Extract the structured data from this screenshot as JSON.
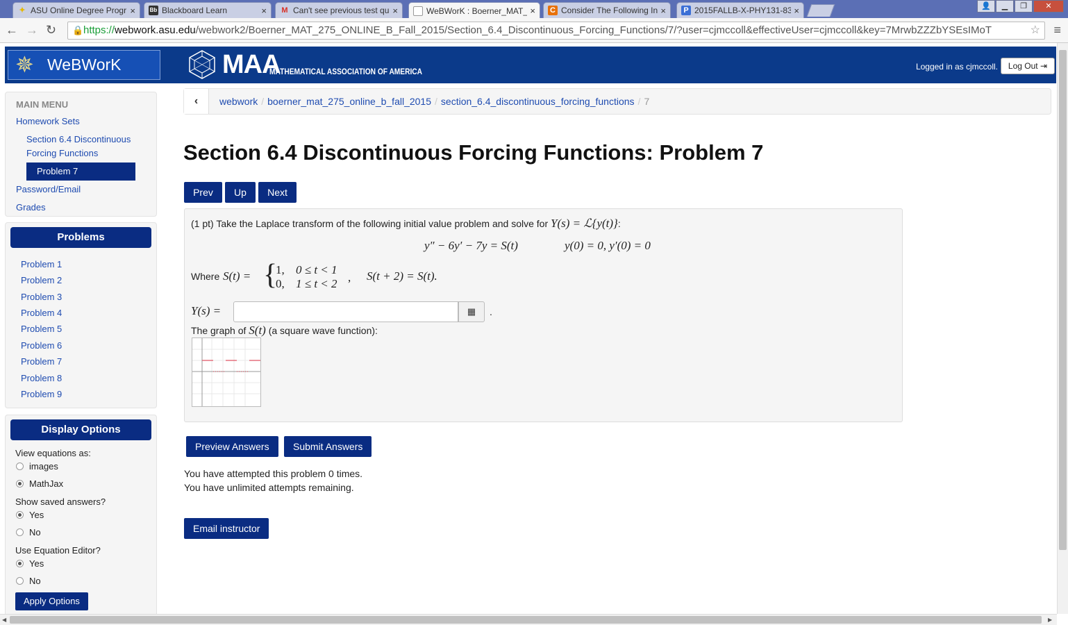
{
  "browser": {
    "tabs": [
      {
        "label": "ASU Online Degree Progr",
        "favicon": "A",
        "color": "#e6b800"
      },
      {
        "label": "Blackboard Learn",
        "favicon": "Bb",
        "color": "#333333"
      },
      {
        "label": "Can't see previous test qu",
        "favicon": "M",
        "color": "#d93025"
      },
      {
        "label": "WeBWorK : Boerner_MAT_",
        "favicon": "□",
        "color": "#777777"
      },
      {
        "label": "Consider The Following In",
        "favicon": "C",
        "color": "#e8710a"
      },
      {
        "label": "2015FALLB-X-PHY131-83",
        "favicon": "P",
        "color": "#3b6fd6"
      }
    ],
    "url_scheme": "https://",
    "url_domain": "webwork.asu.edu",
    "url_path": "/webwork2/Boerner_MAT_275_ONLINE_B_Fall_2015/Section_6.4_Discontinuous_Forcing_Functions/7/?user=cjmccoll&effectiveUser=cjmccoll&key=7MrwbZZZbYSEsIMoT"
  },
  "header": {
    "logo_text": "WeBWorK",
    "maa_big": "MAA",
    "maa_small": "MATHEMATICAL ASSOCIATION OF AMERICA",
    "logged_in": "Logged in as cjmccoll.",
    "logout": "Log Out"
  },
  "sidebar": {
    "main_menu_title": "MAIN MENU",
    "homework_sets": "Homework Sets",
    "section_line1": "Section 6.4 Discontinuous",
    "section_line2": "Forcing Functions",
    "current_problem": "Problem 7",
    "password_email": "Password/Email",
    "grades": "Grades",
    "problems_title": "Problems",
    "problems": [
      "Problem 1",
      "Problem 2",
      "Problem 3",
      "Problem 4",
      "Problem 5",
      "Problem 6",
      "Problem 7",
      "Problem 8",
      "Problem 9"
    ],
    "display_title": "Display Options",
    "view_eq_label": "View equations as:",
    "view_eq_opts": [
      "images",
      "MathJax"
    ],
    "show_saved_label": "Show saved answers?",
    "use_eq_editor_label": "Use Equation Editor?",
    "yes": "Yes",
    "no": "No",
    "apply": "Apply Options"
  },
  "breadcrumb": {
    "items": [
      "webwork",
      "boerner_mat_275_online_b_fall_2015",
      "section_6.4_discontinuous_forcing_functions"
    ],
    "current": "7"
  },
  "main": {
    "title": "Section 6.4 Discontinuous Forcing Functions: Problem 7",
    "prev": "Prev",
    "up": "Up",
    "next": "Next",
    "intro": "(1 pt) Take the Laplace transform of the following initial value problem and solve for",
    "ys_eq": "Y(s) = ℒ{y(t)}",
    "ode": "y″ − 6y′ − 7y = S(t)",
    "ic": "y(0) = 0,  y′(0) = 0",
    "where": "Where",
    "s_of_t": "S(t) =",
    "case1_val": "1,",
    "case1_cond": "0 ≤ t < 1",
    "case2_val": "0,",
    "case2_cond": "1 ≤ t < 2",
    "periodic": "S(t + 2) = S(t).",
    "answer_label": "Y(s) =",
    "graph_caption_pre": "The graph of",
    "graph_caption_var": "S(t)",
    "graph_caption_post": "(a square wave function):",
    "preview": "Preview Answers",
    "submit": "Submit Answers",
    "attempted": "You have attempted this problem 0 times.",
    "unlimited": "You have unlimited attempts remaining.",
    "email": "Email instructor"
  }
}
